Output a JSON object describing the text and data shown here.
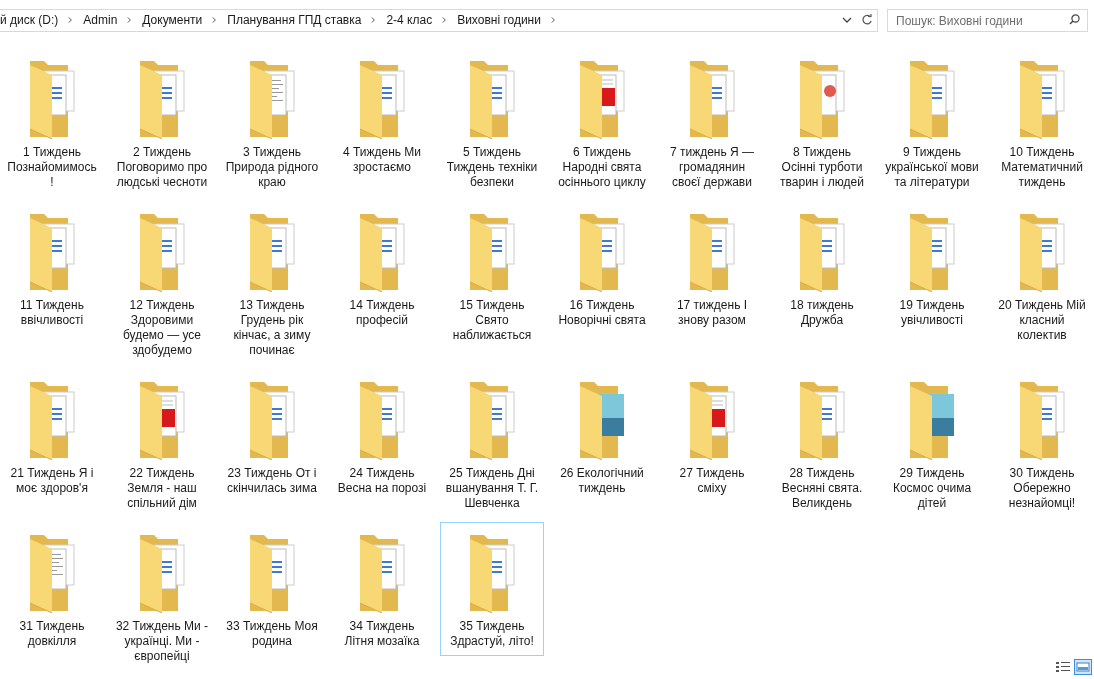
{
  "address_bar": {
    "crumbs": [
      "й диск (D:)",
      "Admin",
      "Документи",
      "Планування ГПД ставка",
      "2-4 клас",
      "Виховні години"
    ]
  },
  "search": {
    "placeholder": "Пошук: Виховні години"
  },
  "folders": [
    {
      "name": "1 Тиждень Познайомимось !",
      "kind": "word",
      "highlighted": false
    },
    {
      "name": "2 Тиждень Поговоримо про людські чесноти",
      "kind": "word",
      "highlighted": false
    },
    {
      "name": "3 Тиждень Природа рідного краю",
      "kind": "text",
      "highlighted": false
    },
    {
      "name": "4 Тиждень Ми зростаємо",
      "kind": "word",
      "highlighted": false
    },
    {
      "name": "5 Тиждень Тиждень техніки безпеки",
      "kind": "word",
      "highlighted": false
    },
    {
      "name": "6 Тиждень Народні свята осіннього циклу",
      "kind": "pdf",
      "highlighted": false
    },
    {
      "name": "7 тиждень Я — громадянин своєї держави",
      "kind": "word",
      "highlighted": false
    },
    {
      "name": "8 Тиждень Осінні турботи тварин і людей",
      "kind": "chart",
      "highlighted": false
    },
    {
      "name": "9 Тиждень української мови та літератури",
      "kind": "word",
      "highlighted": false
    },
    {
      "name": "10 Тиждень Математичний тиждень",
      "kind": "word",
      "highlighted": false
    },
    {
      "name": "11 Тиждень ввічливості",
      "kind": "word",
      "highlighted": false
    },
    {
      "name": "12 Тиждень Здоровими будемо — усе здобудемо",
      "kind": "word",
      "highlighted": false
    },
    {
      "name": "13 Тиждень Грудень рік кінчає, а зиму починає",
      "kind": "word",
      "highlighted": false
    },
    {
      "name": "14 Тиждень професій",
      "kind": "word",
      "highlighted": false
    },
    {
      "name": "15 Тиждень Свято наближається",
      "kind": "word",
      "highlighted": false
    },
    {
      "name": "16 Тиждень Новорічні свята",
      "kind": "word",
      "highlighted": false
    },
    {
      "name": "17 тиждень І знову разом",
      "kind": "word",
      "highlighted": false
    },
    {
      "name": "18 тиждень Дружба",
      "kind": "word",
      "highlighted": false
    },
    {
      "name": "19 Тиждень увічливості",
      "kind": "word",
      "highlighted": false
    },
    {
      "name": "20 Тиждень Мій класний колектив",
      "kind": "word",
      "highlighted": false
    },
    {
      "name": "21 Тиждень Я і моє здоров'я",
      "kind": "word",
      "highlighted": false
    },
    {
      "name": "22 Тиждень Земля - наш спільний дім",
      "kind": "pdf",
      "highlighted": false
    },
    {
      "name": "23 Тиждень От і скінчилась зима",
      "kind": "word",
      "highlighted": false
    },
    {
      "name": "24 Тиждень Весна на порозі",
      "kind": "word",
      "highlighted": false
    },
    {
      "name": "25 Тиждень Дні вшанування Т. Г. Шевченка",
      "kind": "word",
      "highlighted": false
    },
    {
      "name": "26 Екологічний тиждень",
      "kind": "image",
      "highlighted": false
    },
    {
      "name": "27 Тиждень сміху",
      "kind": "pdf",
      "highlighted": false
    },
    {
      "name": "28 Тиждень Весняні свята. Великдень",
      "kind": "word",
      "highlighted": false
    },
    {
      "name": "29 Тиждень Космос очима дітей",
      "kind": "image",
      "highlighted": false
    },
    {
      "name": "30 Тиждень Обережно незнайомці!",
      "kind": "word",
      "highlighted": false
    },
    {
      "name": "31 Тиждень довкілля",
      "kind": "text",
      "highlighted": false
    },
    {
      "name": "32 Тиждень Ми - українці. Ми - європейці",
      "kind": "word",
      "highlighted": false
    },
    {
      "name": "33 Тиждень Моя родина",
      "kind": "word",
      "highlighted": false
    },
    {
      "name": "34 Тиждень Літня мозаїка",
      "kind": "word",
      "highlighted": false
    },
    {
      "name": "35 Тиждень Здрастуй, літо!",
      "kind": "word",
      "highlighted": true
    }
  ]
}
